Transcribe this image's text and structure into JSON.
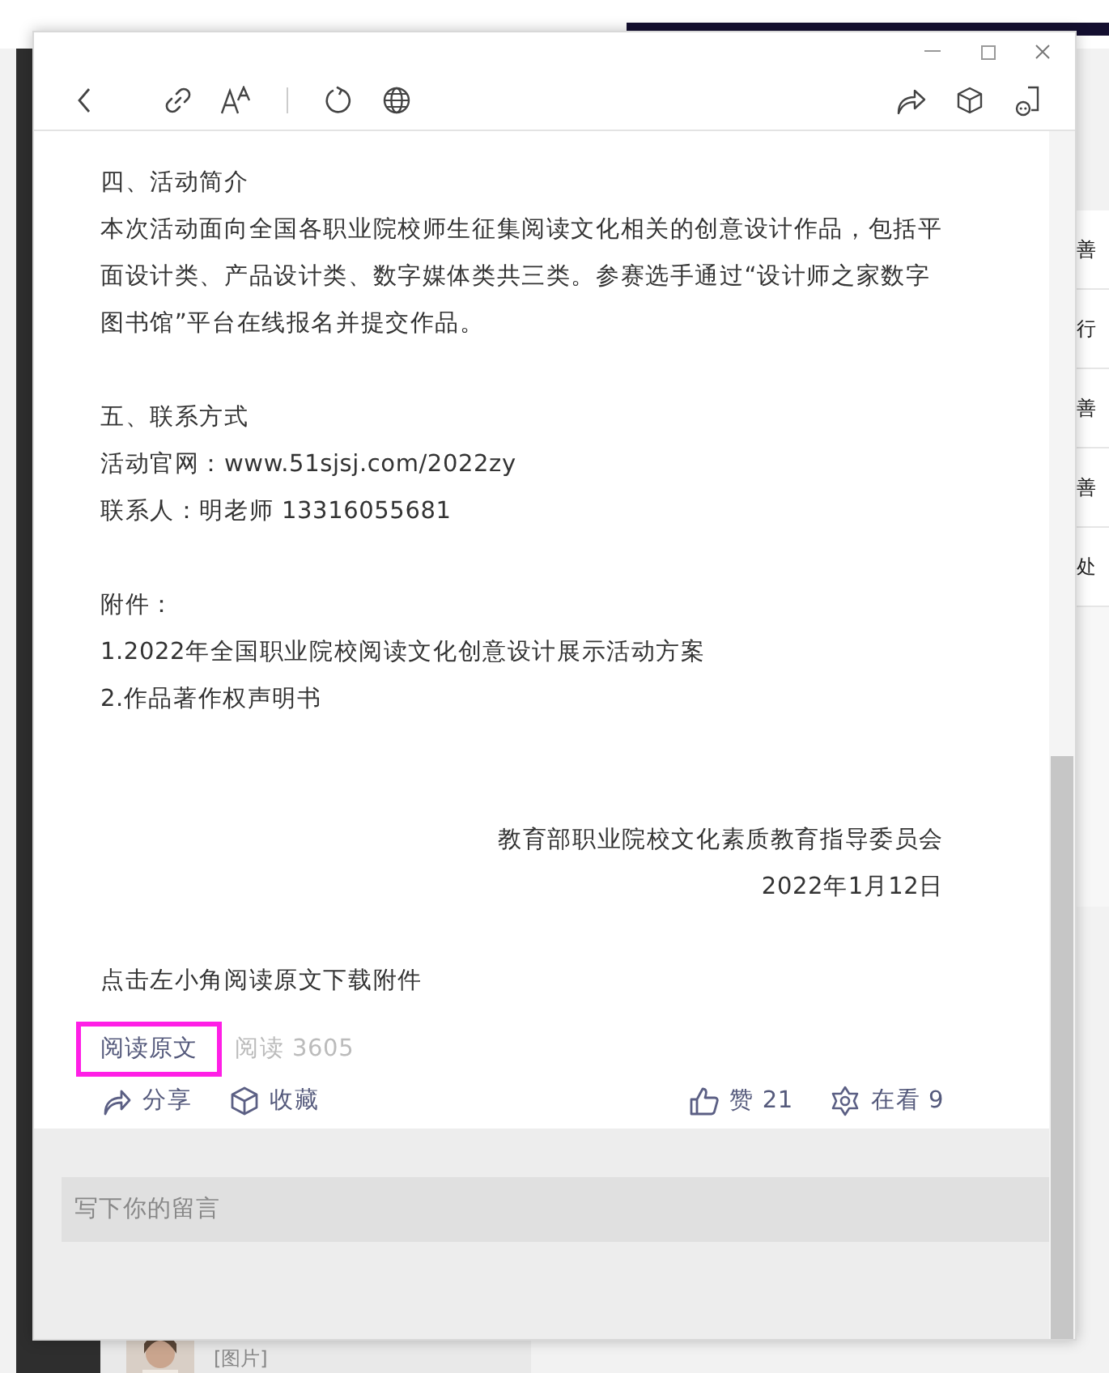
{
  "background": {
    "side_texts": [
      "善",
      "行",
      "善",
      "善",
      "处"
    ],
    "chat_preview": "[图片]"
  },
  "article": {
    "blocks": [
      {
        "kind": "text",
        "text": "四、活动简介"
      },
      {
        "kind": "text",
        "text": "本次活动面向全国各职业院校师生征集阅读文化相关的创意设计作品，包括平面设计类、产品设计类、数字媒体类共三类。参赛选手通过“设计师之家数字图书馆”平台在线报名并提交作品。"
      },
      {
        "kind": "gap"
      },
      {
        "kind": "text",
        "text": "五、联系方式"
      },
      {
        "kind": "text",
        "text": "活动官网：www.51sjsj.com/2022zy"
      },
      {
        "kind": "text",
        "text": "联系人：明老师 13316055681"
      },
      {
        "kind": "gap"
      },
      {
        "kind": "text",
        "text": "附件："
      },
      {
        "kind": "text",
        "text": "1.2022年全国职业院校阅读文化创意设计展示活动方案"
      },
      {
        "kind": "text",
        "text": "2.作品著作权声明书"
      },
      {
        "kind": "gap"
      },
      {
        "kind": "gap"
      },
      {
        "kind": "right",
        "text": "教育部职业院校文化素质教育指导委员会"
      },
      {
        "kind": "right",
        "text": "2022年1月12日"
      },
      {
        "kind": "gap"
      },
      {
        "kind": "text",
        "text": "点击左小角阅读原文下载附件"
      }
    ],
    "read_original": {
      "label": "阅读原文",
      "highlighted": true
    },
    "reads": "阅读 3605",
    "actions": [
      {
        "kind": "share",
        "label": "分享"
      },
      {
        "kind": "collect",
        "label": "收藏"
      },
      {
        "kind": "like",
        "label": "赞 21"
      },
      {
        "kind": "watch",
        "label": "在看 9"
      }
    ]
  },
  "comment": {
    "placeholder": "写下你的留言"
  }
}
